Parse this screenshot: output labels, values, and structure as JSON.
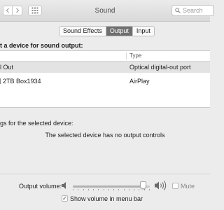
{
  "window": {
    "title": "Sound"
  },
  "toolbar": {
    "back_icon": "chevron-left-icon",
    "forward_icon": "chevron-right-icon",
    "grid_icon": "grid-icon",
    "search_placeholder": "Search",
    "search_value": ""
  },
  "tabs": [
    {
      "label": "Sound Effects",
      "selected": false
    },
    {
      "label": "Output",
      "selected": true
    },
    {
      "label": "Input",
      "selected": false
    }
  ],
  "output": {
    "heading": "t a device for sound output:",
    "columns": {
      "name": "",
      "type": "Type"
    },
    "devices": [
      {
        "name": "l Out",
        "type": "Optical digital-out port",
        "selected": true
      },
      {
        "name": "2TB Box1934",
        "type": "AirPlay",
        "selected": false
      }
    ],
    "settings_label": "gs for the selected device:",
    "no_controls_text": "The selected device has no output controls"
  },
  "volume": {
    "label": "Output volume:",
    "level": 0.95,
    "mute_label": "Mute",
    "mute_checked": false,
    "low_icon": "speaker-low-icon",
    "high_icon": "speaker-high-icon"
  },
  "menubar": {
    "show_label": "Show volume in menu bar",
    "checked": true,
    "check_glyph": "✓"
  },
  "colors": {
    "selected_tab": "#6f6f6f",
    "selected_row": "#e3e3e3"
  }
}
